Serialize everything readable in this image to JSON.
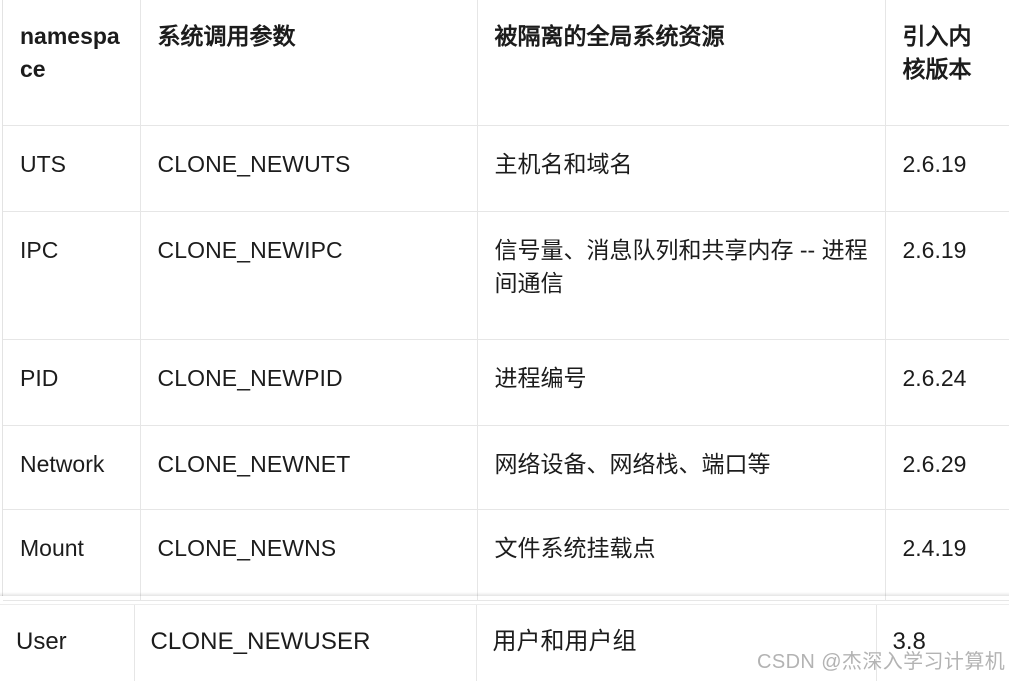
{
  "table": {
    "columns": [
      {
        "key": "namespace",
        "label": "namespace",
        "bold": true
      },
      {
        "key": "clone_flag",
        "label": "系统调用参数",
        "bold": true
      },
      {
        "key": "isolated_resource",
        "label": "被隔离的全局系统资源",
        "bold": true
      },
      {
        "key": "kernel_version",
        "label": "引入内核版本",
        "bold": true
      }
    ],
    "rows": [
      {
        "namespace": "UTS",
        "clone_flag": "CLONE_NEWUTS",
        "isolated_resource": "主机名和域名",
        "kernel_version": "2.6.19"
      },
      {
        "namespace": "IPC",
        "clone_flag": "CLONE_NEWIPC",
        "isolated_resource": "信号量、消息队列和共享内存 -- 进程间通信",
        "kernel_version": "2.6.19"
      },
      {
        "namespace": "PID",
        "clone_flag": "CLONE_NEWPID",
        "isolated_resource": "进程编号",
        "kernel_version": "2.6.24"
      },
      {
        "namespace": "Network",
        "clone_flag": "CLONE_NEWNET",
        "isolated_resource": "网络设备、网络栈、端口等",
        "kernel_version": "2.6.29"
      },
      {
        "namespace": "Mount",
        "clone_flag": "CLONE_NEWNS",
        "isolated_resource": "文件系统挂载点",
        "kernel_version": "2.4.19"
      },
      {
        "namespace": "User",
        "clone_flag": "CLONE_NEWUSER",
        "isolated_resource": "用户和用户组",
        "kernel_version": "3.8"
      }
    ]
  },
  "watermark": {
    "text": "CSDN @杰深入学习计算机",
    "color": "#b3b3b3"
  },
  "colors": {
    "background": "#ffffff",
    "text": "#1c1c1c",
    "border": "#e6e6e6",
    "seam": "#cfcfcf",
    "watermark": "#b3b3b3"
  }
}
